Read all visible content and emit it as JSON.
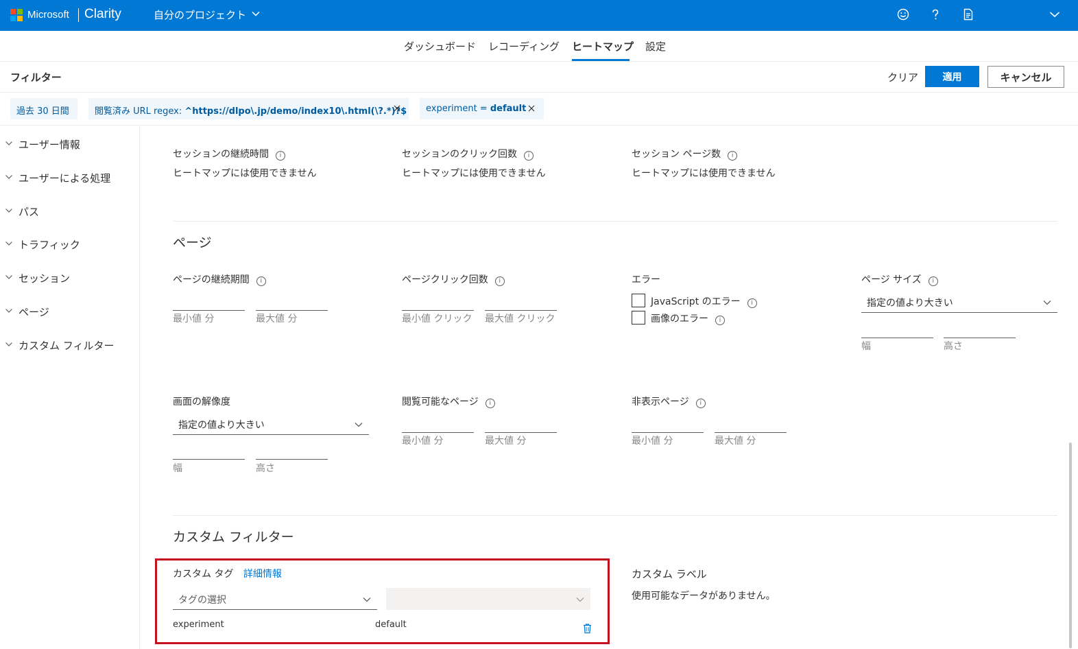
{
  "colors": {
    "accent": "#0078d4",
    "highlight": "#c50f1f"
  },
  "header": {
    "brand_ms": "Microsoft",
    "brand_product": "Clarity",
    "project": "自分のプロジェクト",
    "icons": [
      "smiley-icon",
      "help-icon",
      "document-icon",
      "chevron-down-icon"
    ]
  },
  "nav": {
    "tabs": [
      {
        "label": "ダッシュボード"
      },
      {
        "label": "レコーディング"
      },
      {
        "label": "ヒートマップ",
        "active": true
      },
      {
        "label": "設定"
      }
    ]
  },
  "filter_bar": {
    "title": "フィルター",
    "clear": "クリア",
    "apply": "適用",
    "cancel": "キャンセル"
  },
  "chips": {
    "date": "過去 30 日間",
    "url_prefix": "閲覧済み URL regex: ",
    "url_value": "^https://dlpo\\.jp/demo/index10\\.html(\\?.*)?$",
    "exp_prefix": "experiment = ",
    "exp_value": "default"
  },
  "sidebar": {
    "items": [
      {
        "label": "ユーザー情報"
      },
      {
        "label": "ユーザーによる処理"
      },
      {
        "label": "パス"
      },
      {
        "label": "トラフィック"
      },
      {
        "label": "セッション"
      },
      {
        "label": "ページ"
      },
      {
        "label": "カスタム フィルター"
      }
    ]
  },
  "session": {
    "duration_label": "セッションの継続時間",
    "clicks_label": "セッションのクリック回数",
    "pages_label": "セッション ページ数",
    "unavailable": "ヒートマップには使用できません"
  },
  "page_section": {
    "title": "ページ",
    "duration_label": "ページの継続期間",
    "clicks_label": "ページクリック回数",
    "errors_label": "エラー",
    "js_error": "JavaScript のエラー",
    "image_error": "画像のエラー",
    "page_size_label": "ページ サイズ",
    "greater_than": "指定の値より大きい",
    "width": "幅",
    "height": "高さ",
    "min_minutes": "最小値 分",
    "max_minutes": "最大値 分",
    "min_clicks": "最小値 クリック",
    "max_clicks": "最大値 クリック",
    "resolution_label": "画面の解像度",
    "visible_label": "閲覧可能なページ",
    "hidden_label": "非表示ページ"
  },
  "custom": {
    "title": "カスタム フィルター",
    "tag_label": "カスタム タグ",
    "more_info": "詳細情報",
    "tag_placeholder": "タグの選択",
    "tag_key": "experiment",
    "tag_value": "default",
    "label_title": "カスタム ラベル",
    "no_data": "使用可能なデータがありません。"
  }
}
